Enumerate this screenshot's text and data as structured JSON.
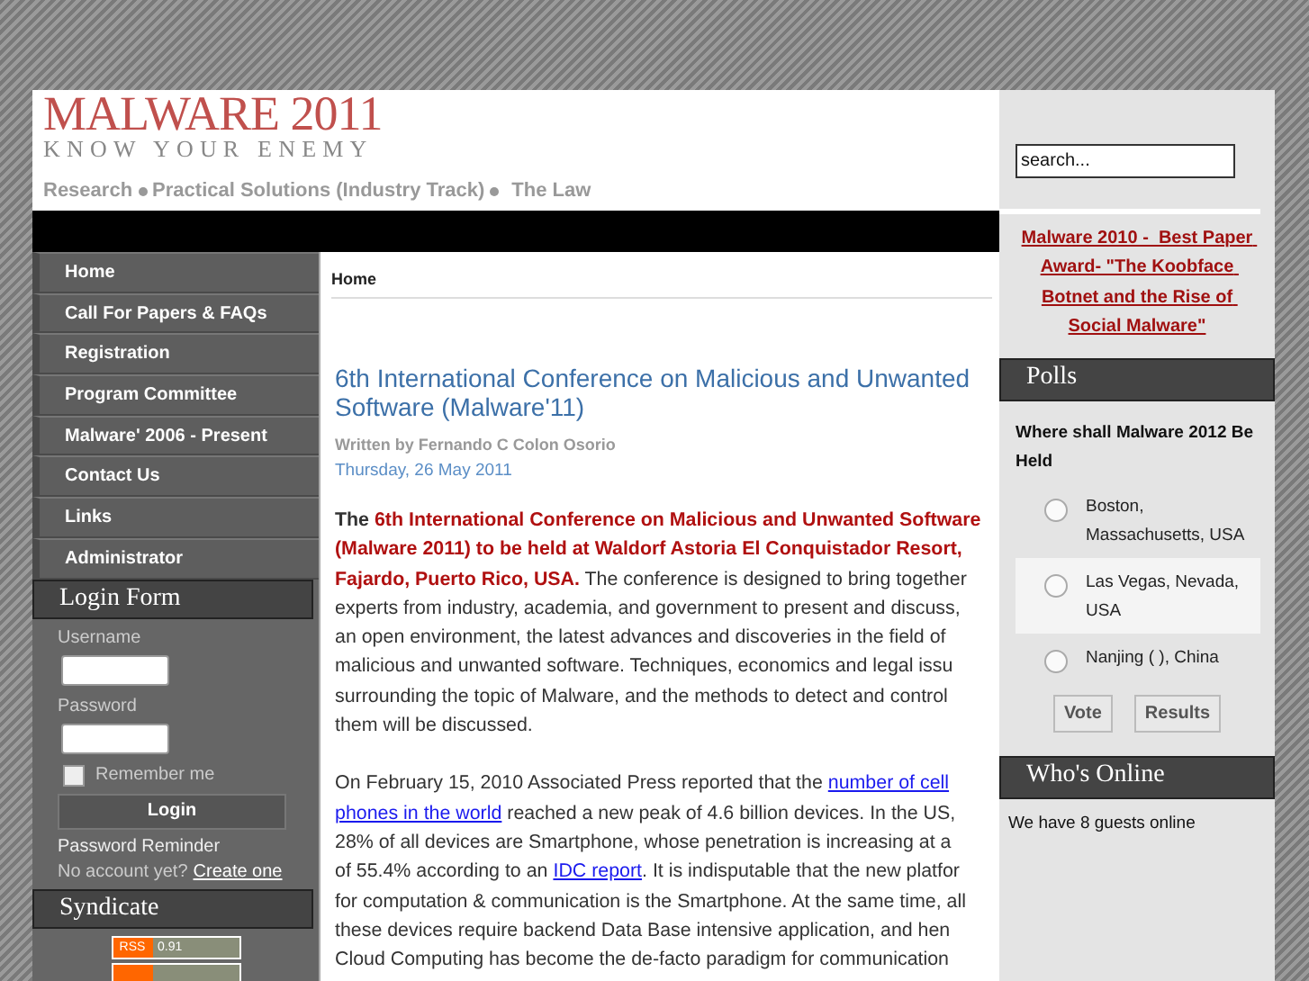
{
  "header": {
    "logo_title": "MALWARE 2011",
    "logo_tagline": "KNOW YOUR ENEMY",
    "nav": [
      "Research",
      "Practical Solutions (Industry Track)",
      "The Law"
    ]
  },
  "menu": [
    {
      "label": "Home"
    },
    {
      "label": "Call For Papers & FAQs"
    },
    {
      "label": "Registration"
    },
    {
      "label": "Program Committee"
    },
    {
      "label": "Malware' 2006 - Present"
    },
    {
      "label": "Contact Us"
    },
    {
      "label": "Links"
    },
    {
      "label": "Administrator"
    }
  ],
  "login": {
    "title": "Login Form",
    "username_label": "Username",
    "password_label": "Password",
    "remember_label": "Remember me",
    "remember_checked": false,
    "button": "Login",
    "reminder": "Password Reminder",
    "no_account": "No account yet?",
    "create_link": "Create one"
  },
  "syndicate": {
    "title": "Syndicate",
    "badges": [
      {
        "kind": "rss",
        "tag": "RSS",
        "version": "0.91"
      },
      {
        "kind": "rss"
      }
    ]
  },
  "breadcrumb": "Home",
  "article": {
    "title": "6th International Conference on Malicious and Unwanted Software (Malware'11)",
    "author": "Written by Fernando C Colon Osorio",
    "date": "Thursday, 26 May 2011",
    "paragraphs": [
      [
        [
          {
            "kind": "strong",
            "text": "The "
          },
          {
            "kind": "highlight",
            "text": "6th International Conference on Malicious and Unwanted Software"
          }
        ],
        [
          {
            "kind": "highlight",
            "text": "(Malware 2011) to be held at Waldorf Astoria El Conquistador Resort,"
          }
        ],
        [
          {
            "kind": "highlight",
            "text": "Fajardo, Puerto Rico, USA."
          },
          {
            "kind": "text",
            "text": " The conference is designed to bring together"
          }
        ],
        [
          {
            "kind": "text",
            "text": "experts from industry, academia, and government to present and discuss,"
          }
        ],
        [
          {
            "kind": "text",
            "text": "an open environment, the latest advances and discoveries in the field of"
          }
        ],
        [
          {
            "kind": "text",
            "text": "malicious and unwanted software. Techniques, economics and legal issu"
          }
        ],
        [
          {
            "kind": "text",
            "text": "surrounding the topic of Malware, and the methods to detect and control"
          }
        ],
        [
          {
            "kind": "text",
            "text": "them will be discussed."
          }
        ]
      ],
      [
        [
          {
            "kind": "text",
            "text": "On February 15, 2010 Associated  Press reported that the "
          },
          {
            "kind": "link",
            "text": "number of cell"
          }
        ],
        [
          {
            "kind": "link",
            "text": "phones in the world"
          },
          {
            "kind": "text",
            "text": " reached a new peak of 4.6 billion devices. In the US,"
          }
        ],
        [
          {
            "kind": "text",
            "text": "28% of all devices are Smartphone, whose penetration is increasing at a"
          }
        ],
        [
          {
            "kind": "text",
            "text": "of 55.4% according to an "
          },
          {
            "kind": "link",
            "text": "IDC report"
          },
          {
            "kind": "text",
            "text": ". It is indisputable that the new platfor"
          }
        ],
        [
          {
            "kind": "text",
            "text": "for computation & communication is the Smartphone. At the same time, all"
          }
        ],
        [
          {
            "kind": "text",
            "text": "these devices require backend Data Base intensive application, and hen"
          }
        ],
        [
          {
            "kind": "text",
            "text": "Cloud Computing has become the de-facto paradigm for communication"
          }
        ]
      ]
    ]
  },
  "search": {
    "placeholder": "search..."
  },
  "award_link": "Malware 2010 -  Best Paper Award- \"The Koobface Botnet and the Rise of Social Malware\"",
  "polls": {
    "title": "Polls",
    "question": "Where shall Malware 2012 Be Held",
    "options": [
      {
        "label": "Boston, Massachusetts, USA",
        "selected": false,
        "highlighted": false
      },
      {
        "label": "Las Vegas, Nevada, USA",
        "selected": false,
        "highlighted": true
      },
      {
        "label": "Nanjing (  ), China",
        "selected": false,
        "highlighted": false
      }
    ],
    "buttons": [
      "Vote",
      "Results"
    ]
  },
  "whos_online": {
    "title": "Who's Online",
    "text": "We have 8 guests online"
  }
}
